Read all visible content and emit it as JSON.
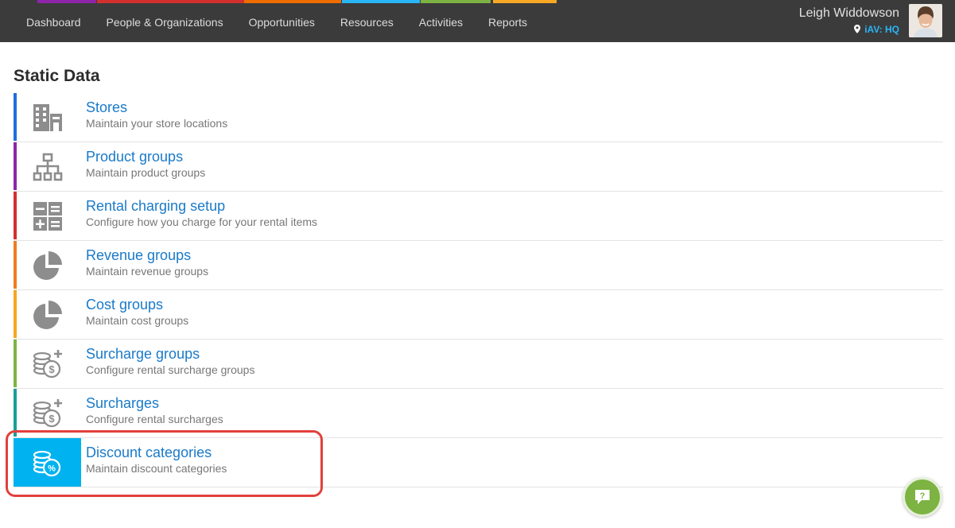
{
  "nav": {
    "items": [
      {
        "label": "Dashboard",
        "color": "#8e24aa"
      },
      {
        "label": "People & Organizations",
        "color": "#d32f2f"
      },
      {
        "label": "Opportunities",
        "color": "#ef6c00"
      },
      {
        "label": "Resources",
        "color": "#29b6f6"
      },
      {
        "label": "Activities",
        "color": "#7cb342"
      },
      {
        "label": "Reports",
        "color": "#f9a825"
      }
    ]
  },
  "user": {
    "name": "Leigh Widdowson",
    "location": "iAV: HQ"
  },
  "page": {
    "title": "Static Data"
  },
  "static_items": [
    {
      "title": "Stores",
      "description": "Maintain your store locations",
      "icon": "building-icon",
      "color": "#1e6fd9"
    },
    {
      "title": "Product groups",
      "description": "Maintain product groups",
      "icon": "hierarchy-icon",
      "color": "#8e24aa"
    },
    {
      "title": "Rental charging setup",
      "description": "Configure how you charge for your rental items",
      "icon": "calculator-icon",
      "color": "#d32f2f"
    },
    {
      "title": "Revenue groups",
      "description": "Maintain revenue groups",
      "icon": "pie-chart-icon",
      "color": "#ef7d22"
    },
    {
      "title": "Cost groups",
      "description": "Maintain cost groups",
      "icon": "pie-chart-icon",
      "color": "#f5a623"
    },
    {
      "title": "Surcharge groups",
      "description": "Configure rental surcharge groups",
      "icon": "coins-plus-icon",
      "color": "#7cb342"
    },
    {
      "title": "Surcharges",
      "description": "Configure rental surcharges",
      "icon": "coins-plus-icon",
      "color": "#1a9e97"
    },
    {
      "title": "Discount categories",
      "description": "Maintain discount categories",
      "icon": "coins-percent-icon",
      "color": "#00b2f0",
      "active": true
    }
  ],
  "help": {
    "icon": "help-chat-icon",
    "glyph": "?"
  }
}
